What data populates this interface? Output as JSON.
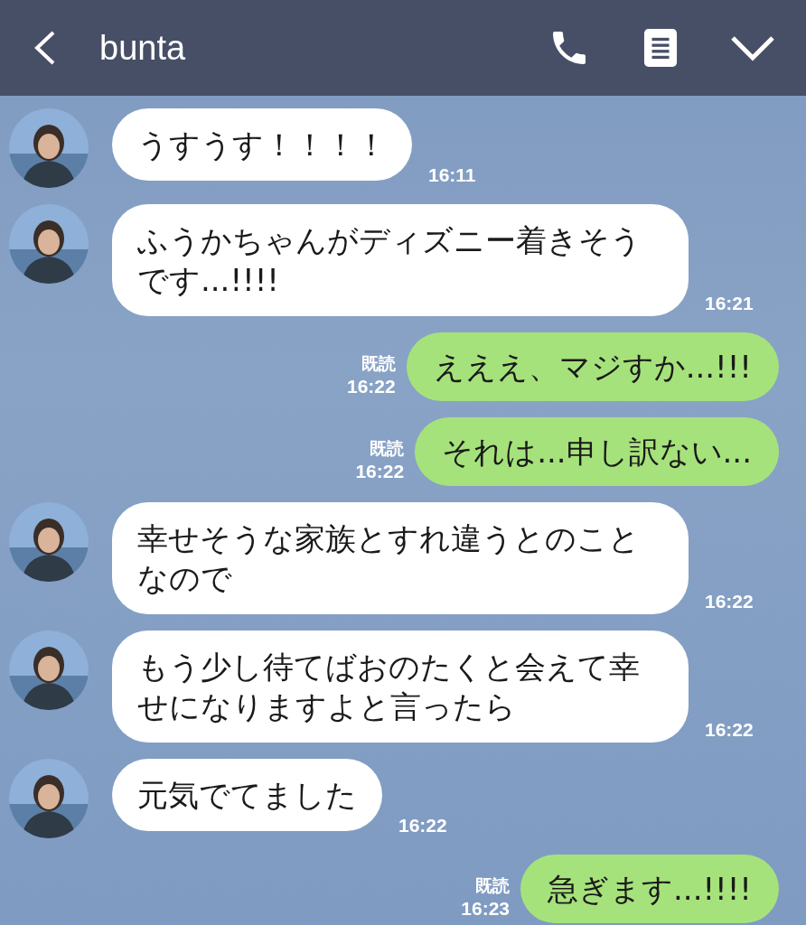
{
  "header": {
    "title": "bunta"
  },
  "messages": [
    {
      "kind": "received",
      "text": "うすうす！！！！",
      "time": "16:11"
    },
    {
      "kind": "received",
      "text": "ふうかちゃんがディズニー着きそうです...!!!!",
      "time": "16:21"
    },
    {
      "kind": "sent",
      "text": "えええ、マジすか...!!!",
      "read": "既読",
      "time": "16:22"
    },
    {
      "kind": "sent",
      "text": "それは...申し訳ない...",
      "read": "既読",
      "time": "16:22"
    },
    {
      "kind": "received",
      "text": "幸せそうな家族とすれ違うとのことなので",
      "time": "16:22"
    },
    {
      "kind": "received",
      "text": "もう少し待てばおのたくと会えて幸せになりますよと言ったら",
      "time": "16:22"
    },
    {
      "kind": "received",
      "text": "元気でてました",
      "time": "16:22"
    },
    {
      "kind": "sent",
      "text": "急ぎます...!!!!",
      "read": "既読",
      "time": "16:23"
    }
  ]
}
